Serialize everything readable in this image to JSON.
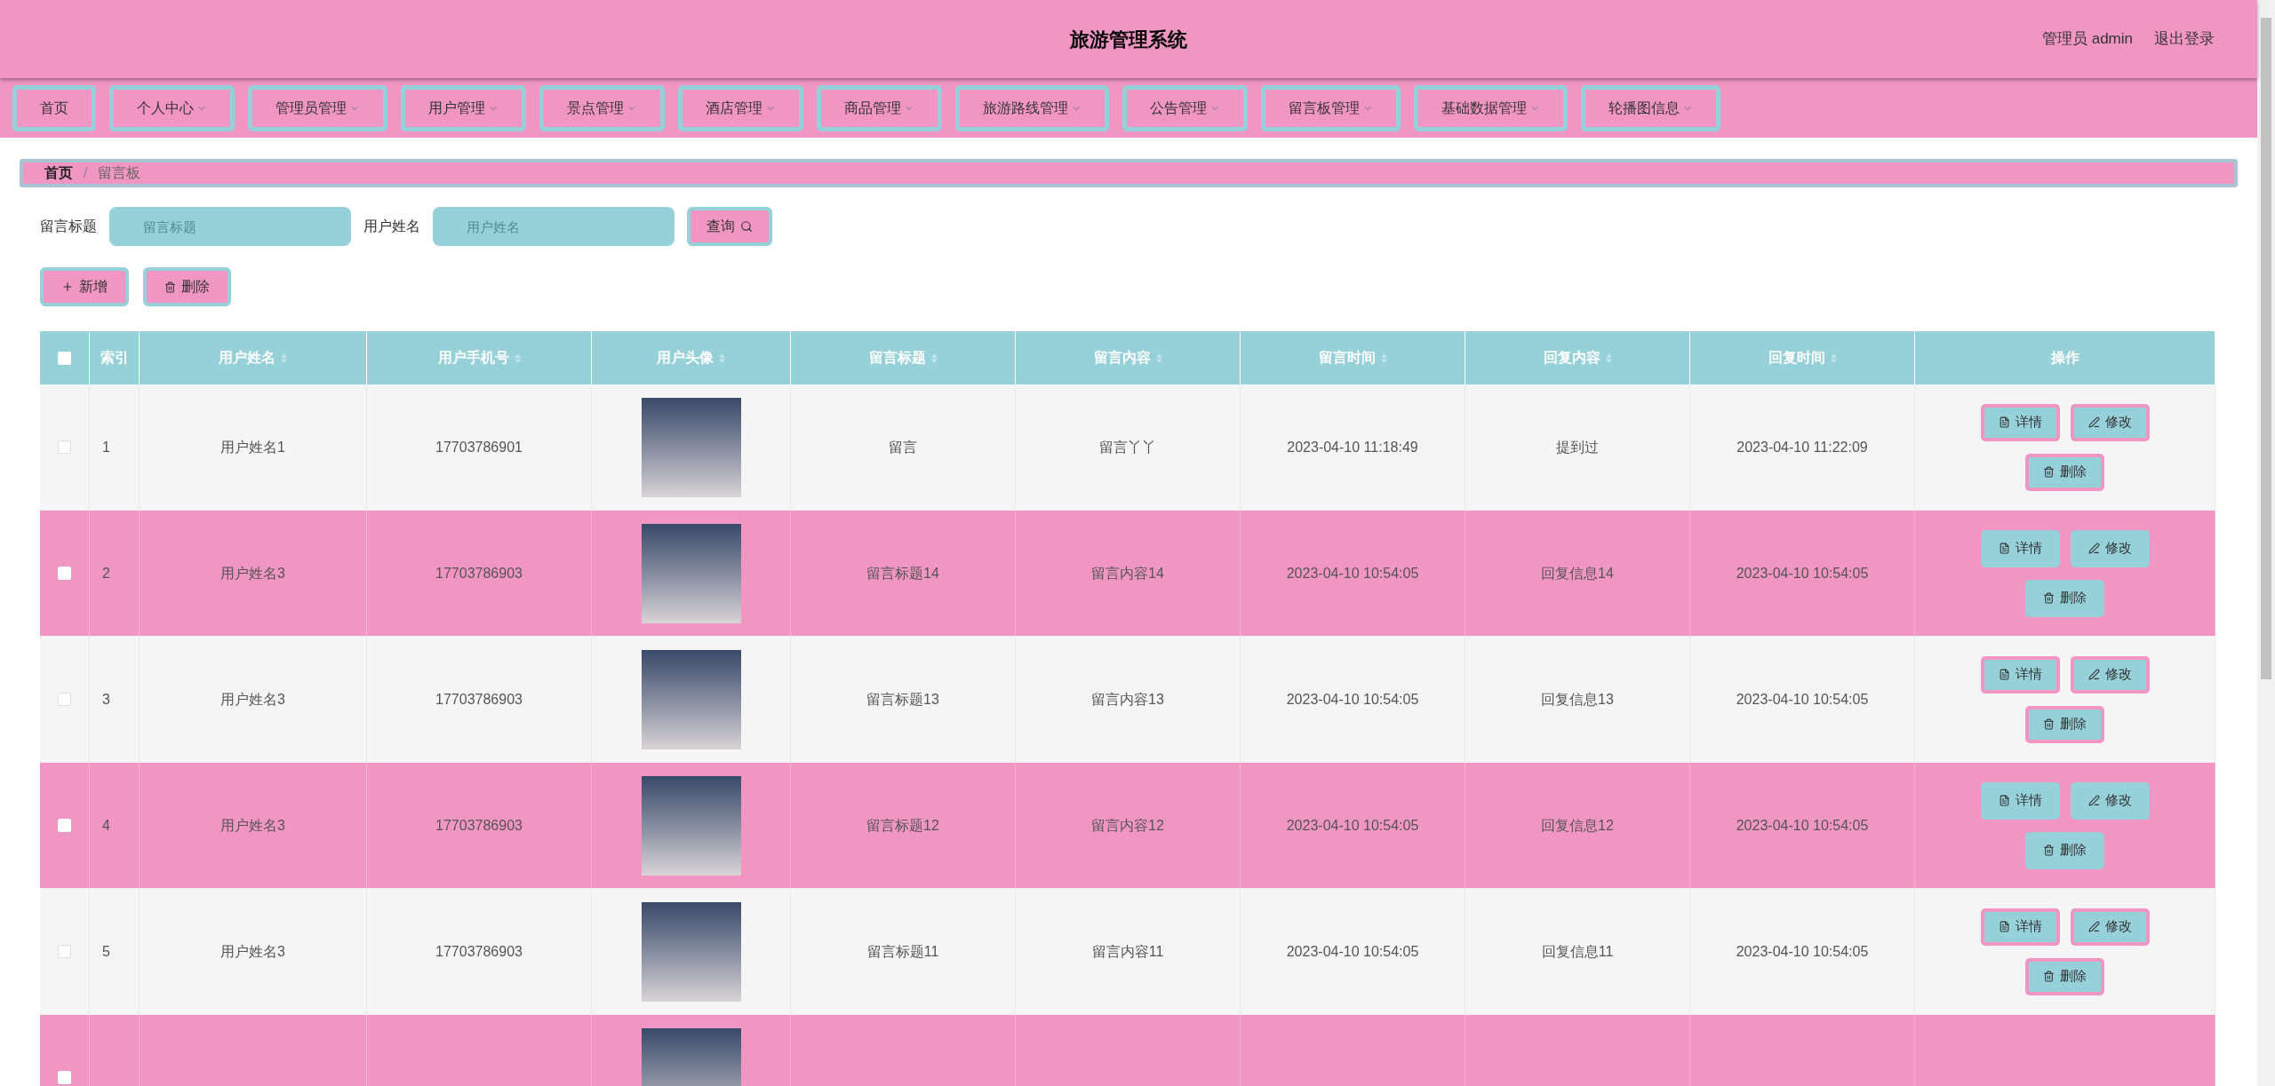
{
  "header": {
    "title": "旅游管理系统",
    "user": "管理员 admin",
    "logout": "退出登录"
  },
  "nav": [
    {
      "label": "首页",
      "dropdown": false
    },
    {
      "label": "个人中心",
      "dropdown": true
    },
    {
      "label": "管理员管理",
      "dropdown": true
    },
    {
      "label": "用户管理",
      "dropdown": true
    },
    {
      "label": "景点管理",
      "dropdown": true
    },
    {
      "label": "酒店管理",
      "dropdown": true
    },
    {
      "label": "商品管理",
      "dropdown": true
    },
    {
      "label": "旅游路线管理",
      "dropdown": true
    },
    {
      "label": "公告管理",
      "dropdown": true
    },
    {
      "label": "留言板管理",
      "dropdown": true
    },
    {
      "label": "基础数据管理",
      "dropdown": true
    },
    {
      "label": "轮播图信息",
      "dropdown": true
    }
  ],
  "breadcrumb": [
    "首页",
    "留言板"
  ],
  "breadcrumb_separator": "/",
  "search": {
    "fields": [
      {
        "label": "留言标题",
        "placeholder": "留言标题"
      },
      {
        "label": "用户姓名",
        "placeholder": "用户姓名"
      }
    ],
    "button": "查询"
  },
  "actions": [
    {
      "kind": "add",
      "label": "新增"
    },
    {
      "kind": "delete",
      "label": "删除"
    }
  ],
  "table": {
    "header_checked": false,
    "columns": [
      {
        "label": "索引",
        "sortable": false
      },
      {
        "label": "用户姓名",
        "sortable": true
      },
      {
        "label": "用户手机号",
        "sortable": true
      },
      {
        "label": "用户头像",
        "sortable": true
      },
      {
        "label": "留言标题",
        "sortable": true
      },
      {
        "label": "留言内容",
        "sortable": true
      },
      {
        "label": "留言时间",
        "sortable": true
      },
      {
        "label": "回复内容",
        "sortable": true
      },
      {
        "label": "回复时间",
        "sortable": true
      },
      {
        "label": "操作",
        "sortable": false
      }
    ],
    "rows": [
      {
        "checked": false,
        "index": "1",
        "cells": [
          "用户姓名1",
          "17703786901",
          "留言",
          "留言丫丫",
          "2023-04-10 11:18:49",
          "提到过",
          "2023-04-10 11:22:09"
        ],
        "actions": [
          {
            "kind": "detail",
            "label": "详情"
          },
          {
            "kind": "edit",
            "label": "修改"
          },
          {
            "kind": "delete",
            "label": "删除"
          }
        ]
      },
      {
        "checked": false,
        "index": "2",
        "cells": [
          "用户姓名3",
          "17703786903",
          "留言标题14",
          "留言内容14",
          "2023-04-10 10:54:05",
          "回复信息14",
          "2023-04-10 10:54:05"
        ],
        "actions": [
          {
            "kind": "detail",
            "label": "详情"
          },
          {
            "kind": "edit",
            "label": "修改"
          },
          {
            "kind": "delete",
            "label": "删除"
          }
        ]
      },
      {
        "checked": false,
        "index": "3",
        "cells": [
          "用户姓名3",
          "17703786903",
          "留言标题13",
          "留言内容13",
          "2023-04-10 10:54:05",
          "回复信息13",
          "2023-04-10 10:54:05"
        ],
        "actions": [
          {
            "kind": "detail",
            "label": "详情"
          },
          {
            "kind": "edit",
            "label": "修改"
          },
          {
            "kind": "delete",
            "label": "删除"
          }
        ]
      },
      {
        "checked": false,
        "index": "4",
        "cells": [
          "用户姓名3",
          "17703786903",
          "留言标题12",
          "留言内容12",
          "2023-04-10 10:54:05",
          "回复信息12",
          "2023-04-10 10:54:05"
        ],
        "actions": [
          {
            "kind": "detail",
            "label": "详情"
          },
          {
            "kind": "edit",
            "label": "修改"
          },
          {
            "kind": "delete",
            "label": "删除"
          }
        ]
      },
      {
        "checked": false,
        "index": "5",
        "cells": [
          "用户姓名3",
          "17703786903",
          "留言标题11",
          "留言内容11",
          "2023-04-10 10:54:05",
          "回复信息11",
          "2023-04-10 10:54:05"
        ],
        "actions": [
          {
            "kind": "detail",
            "label": "详情"
          },
          {
            "kind": "edit",
            "label": "修改"
          },
          {
            "kind": "delete",
            "label": "删除"
          }
        ]
      },
      {
        "checked": false
      }
    ]
  }
}
